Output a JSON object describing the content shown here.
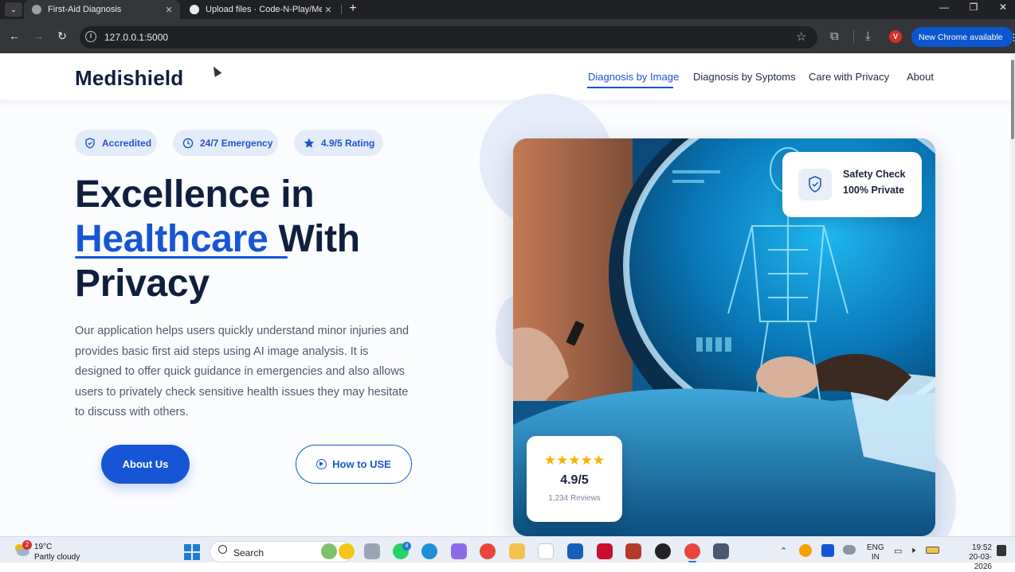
{
  "browser": {
    "tabs": [
      {
        "title": "First-Aid Diagnosis",
        "close": "✕"
      },
      {
        "title": "Upload files · Code-N-Play/Med",
        "close": "✕"
      }
    ],
    "new_tab": "+",
    "window_controls": {
      "minimize": "—",
      "maximize": "❐",
      "close": "✕"
    },
    "url": "127.0.0.1:5000",
    "profile_initial": "V",
    "update_label": "New Chrome available",
    "update_menu": "⋮"
  },
  "site": {
    "logo": "Medishield",
    "nav": [
      {
        "label": "Diagnosis by Image",
        "active": true
      },
      {
        "label": "Diagnosis by Syptoms"
      },
      {
        "label": "Care with Privacy"
      },
      {
        "label": "About"
      }
    ],
    "badges": [
      {
        "label": "Accredited",
        "icon": "shield-icon"
      },
      {
        "label": "24/7 Emergency",
        "icon": "clock-icon"
      },
      {
        "label": "4.9/5 Rating",
        "icon": "star-icon"
      }
    ],
    "headline": {
      "line1": "Excellence in",
      "highlight": "Healthcare",
      "line2_rest": " With",
      "line3": "Privacy"
    },
    "description": "Our application helps users quickly understand minor injuries and provides basic first aid steps using AI image analysis. It is designed to offer quick guidance in emergencies and also allows users to privately check sensitive health issues they may hesitate to discuss with others.",
    "buttons": {
      "primary": "About Us",
      "secondary": "How to USE"
    },
    "safety_card": {
      "line1": "Safety Check",
      "line2": "100% Private"
    },
    "rating_card": {
      "stars": "★★★★★",
      "value": "4.9/5",
      "reviews": "1,234 Reviews"
    }
  },
  "taskbar": {
    "weather": {
      "temp": "19°C",
      "desc": "Partly cloudy",
      "badge": "2"
    },
    "search_label": "Search",
    "whatsapp_badge": "4",
    "lang": {
      "line1": "ENG",
      "line2": "IN"
    },
    "clock": {
      "time": "19:52",
      "date": "20-03-2026"
    }
  },
  "colors": {
    "brand_blue": "#1656d6",
    "heading_navy": "#0f1f3d",
    "badge_bg": "#e4ecfa",
    "chrome_dark": "#202124",
    "rating_star": "#f5b400"
  }
}
